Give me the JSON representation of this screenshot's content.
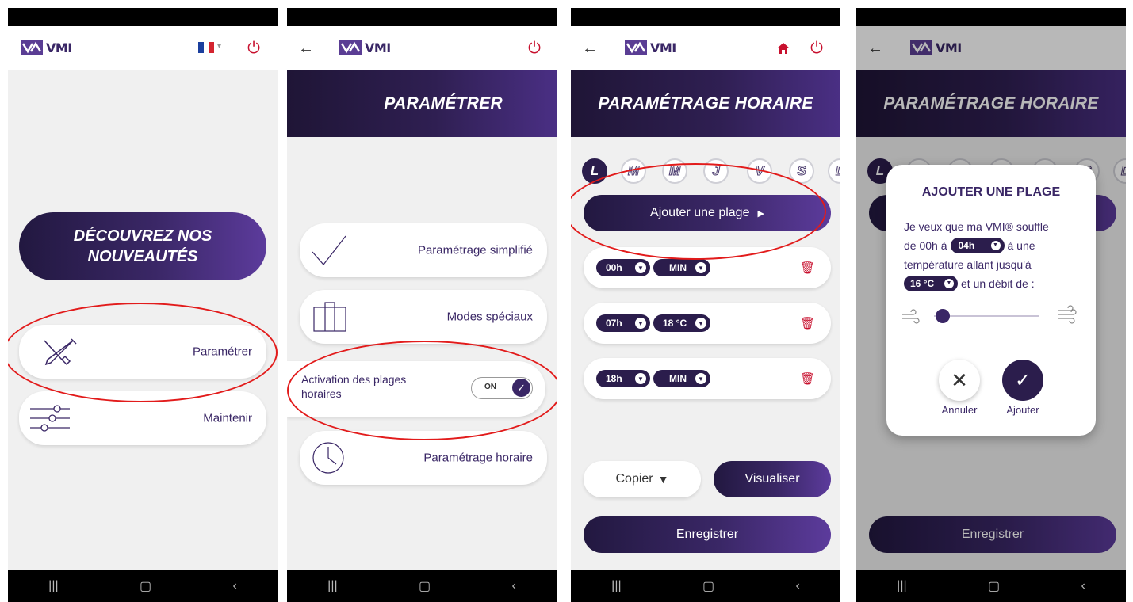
{
  "brand": {
    "logo_text": "VMI",
    "accent": "#3a2766",
    "danger": "#c8102e"
  },
  "screen1": {
    "promo_title": "DÉCOUVREZ NOS NOUVEAUTÉS",
    "menu": [
      {
        "label": "Paramétrer",
        "icon": "tools-icon"
      },
      {
        "label": "Maintenir",
        "icon": "sliders-icon"
      }
    ]
  },
  "screen2": {
    "title": "PARAMÉTRER",
    "items": [
      {
        "label": "Paramétrage simplifié",
        "icon": "checkmark-icon"
      },
      {
        "label": "Modes spéciaux",
        "icon": "suitcase-icon"
      },
      {
        "label": "Paramétrage horaire",
        "icon": "clock-icon"
      }
    ],
    "activation": {
      "label": "Activation des plages horaires",
      "toggle": "ON"
    }
  },
  "screen3": {
    "title": "PARAMÉTRAGE HORAIRE",
    "days": [
      "L",
      "M",
      "M",
      "J",
      "V",
      "S",
      "D"
    ],
    "add_button": "Ajouter une plage",
    "ranges": [
      {
        "hour": "00h",
        "value": "MIN"
      },
      {
        "hour": "07h",
        "value": "18 °C"
      },
      {
        "hour": "18h",
        "value": "MIN"
      }
    ],
    "copy_button": "Copier",
    "view_button": "Visualiser",
    "save_button": "Enregistrer"
  },
  "screen4": {
    "title": "PARAMÉTRAGE HORAIRE",
    "dialog_title": "AJOUTER UNE PLAGE",
    "text1": "Je veux que ma VMI® souffle",
    "text2": "de 00h à",
    "hour_value": "04h",
    "text3": "à une",
    "text4": "température allant jusqu'à",
    "temp_value": "16 °C",
    "text5": "et un débit de :",
    "slider_level": 0.05,
    "cancel_label": "Annuler",
    "add_label": "Ajouter",
    "save_button": "Enregistrer"
  }
}
